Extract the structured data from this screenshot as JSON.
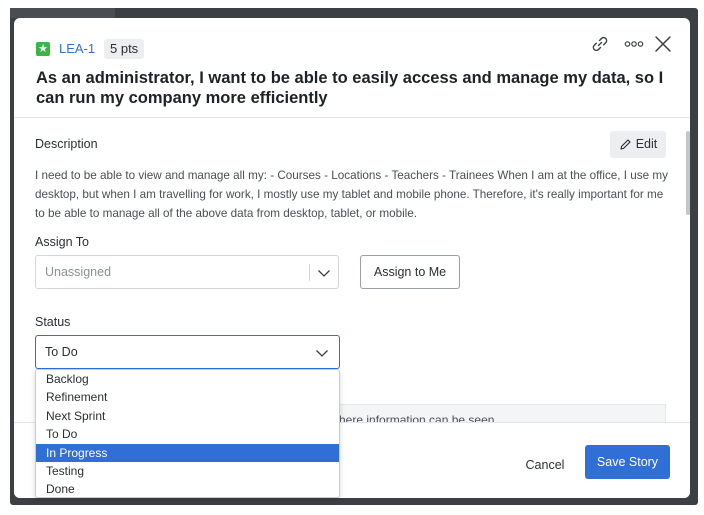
{
  "story": {
    "key": "LEA-1",
    "points": "5 pts",
    "title": "As an administrator, I want to be able to easily access and manage my data, so I can run my company more efficiently"
  },
  "header_icons": [
    "link-icon",
    "more-icon",
    "close-icon"
  ],
  "description": {
    "label": "Description",
    "edit_label": "Edit",
    "text": "I need to be able to view and manage all my: - Courses - Locations - Teachers - Trainees When I am at the office, I use my desktop, but when I am travelling for work, I mostly use my tablet and mobile phone. Therefore, it's really important for me to be able to manage all of the above data from desktop, tablet, or mobile."
  },
  "assign": {
    "label": "Assign To",
    "value": "Unassigned",
    "assign_me_label": "Assign to Me"
  },
  "status": {
    "label": "Status",
    "value": "To Do",
    "options": [
      "Backlog",
      "Refinement",
      "Next Sprint",
      "To Do",
      "In Progress",
      "Testing",
      "Done"
    ],
    "highlighted": "In Progress"
  },
  "info_text": "here information can be seen",
  "footer": {
    "cancel_label": "Cancel",
    "save_label": "Save Story"
  },
  "colors": {
    "accent": "#2f6fd6",
    "story_badge": "#3cb44a",
    "backdrop": "#3c3f44"
  }
}
